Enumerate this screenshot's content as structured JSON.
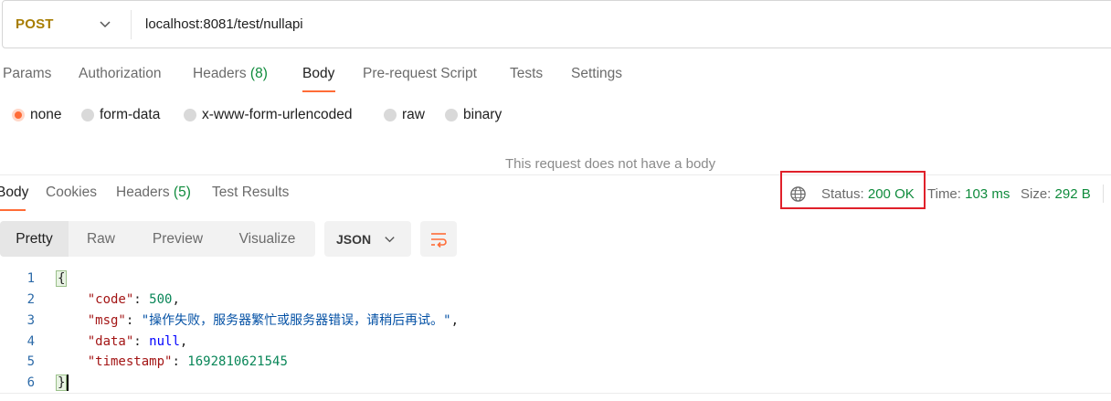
{
  "request": {
    "method": "POST",
    "url": "localhost:8081/test/nullapi"
  },
  "request_tabs": [
    {
      "label": "Params"
    },
    {
      "label": "Authorization"
    },
    {
      "label": "Headers",
      "count": "(8)"
    },
    {
      "label": "Body",
      "active": true
    },
    {
      "label": "Pre-request Script"
    },
    {
      "label": "Tests"
    },
    {
      "label": "Settings"
    }
  ],
  "body_types": [
    {
      "label": "none",
      "selected": true
    },
    {
      "label": "form-data"
    },
    {
      "label": "x-www-form-urlencoded"
    },
    {
      "label": "raw"
    },
    {
      "label": "binary"
    }
  ],
  "no_body_message": "This request does not have a body",
  "response_tabs": [
    {
      "label": "Body",
      "active": true
    },
    {
      "label": "Cookies"
    },
    {
      "label": "Headers",
      "count": "(5)"
    },
    {
      "label": "Test Results"
    }
  ],
  "status": {
    "status_label": "Status:",
    "status_value": "200 OK",
    "time_label": "Time:",
    "time_value": "103 ms",
    "size_label": "Size:",
    "size_value": "292 B"
  },
  "view_modes": [
    {
      "label": "Pretty",
      "active": true
    },
    {
      "label": "Raw"
    },
    {
      "label": "Preview"
    },
    {
      "label": "Visualize"
    }
  ],
  "format": "JSON",
  "icons": {
    "method_dropdown": "chevron-down-icon",
    "network": "globe-icon",
    "format_dropdown": "chevron-down-icon",
    "wrap": "wrap-lines-icon"
  },
  "colors": {
    "accent": "#ff6c37",
    "method": "#a77d00",
    "success": "#0f8b3c",
    "highlight_border": "#e0202a"
  },
  "response_body": {
    "line_numbers": [
      "1",
      "2",
      "3",
      "4",
      "5",
      "6"
    ],
    "open_brace": "{",
    "close_brace": "}",
    "fields": [
      {
        "key": "\"code\"",
        "value": "500"
      },
      {
        "key": "\"msg\"",
        "value": "\"操作失败，服务器繁忙或服务器错误，请稍后再试。\""
      },
      {
        "key": "\"data\"",
        "value": "null"
      },
      {
        "key": "\"timestamp\"",
        "value": "1692810621545"
      }
    ]
  }
}
